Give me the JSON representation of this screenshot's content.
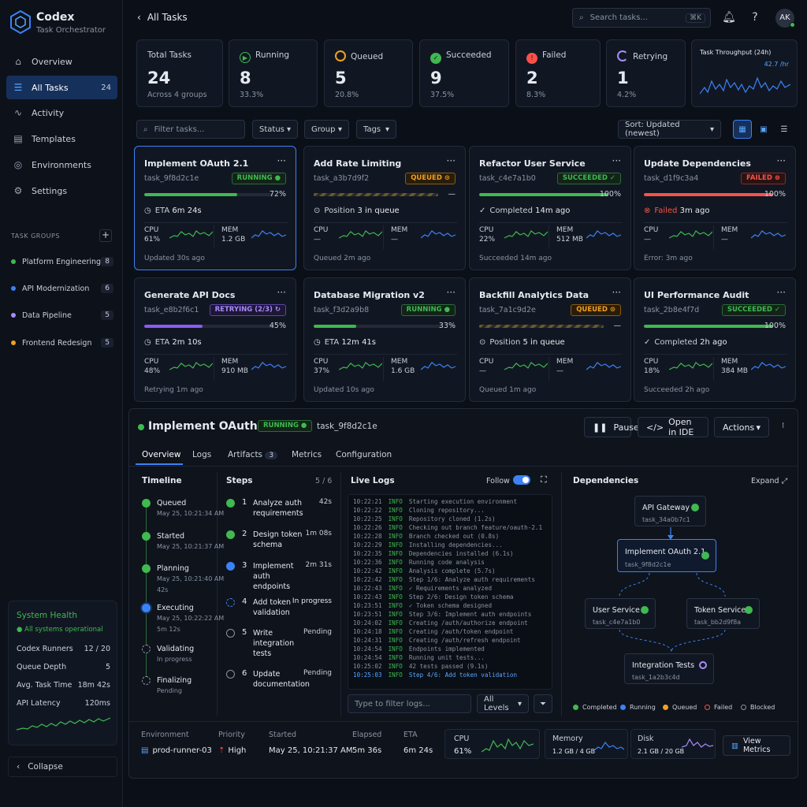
{
  "brand": {
    "name": "Codex",
    "subtitle": "Task Orchestrator"
  },
  "nav": [
    {
      "label": "Overview",
      "icon": "home-icon"
    },
    {
      "label": "All Tasks",
      "icon": "list-icon",
      "count": "24",
      "active": true
    },
    {
      "label": "Activity",
      "icon": "activity-icon"
    },
    {
      "label": "Templates",
      "icon": "template-icon"
    },
    {
      "label": "Environments",
      "icon": "environment-icon"
    },
    {
      "label": "Settings",
      "icon": "gear-icon"
    }
  ],
  "groups": {
    "title": "TASK GROUPS",
    "items": [
      {
        "label": "Platform Engineering",
        "count": "8",
        "color": "#3fb950"
      },
      {
        "label": "API Modernization",
        "count": "6",
        "color": "#3b82f6"
      },
      {
        "label": "Data Pipeline",
        "count": "5",
        "color": "#a78bfa"
      },
      {
        "label": "Frontend Redesign",
        "count": "5",
        "color": "#f0a020"
      }
    ]
  },
  "health": {
    "title": "System Health",
    "status": "All systems operational",
    "rows": [
      {
        "label": "Codex Runners",
        "value": "12 / 20"
      },
      {
        "label": "Queue Depth",
        "value": "5"
      },
      {
        "label": "Avg. Task Time",
        "value": "18m 42s"
      },
      {
        "label": "API Latency",
        "value": "120ms"
      }
    ]
  },
  "collapse_label": "Collapse",
  "topbar": {
    "title": "All Tasks",
    "search_placeholder": "Search tasks...",
    "shortcut": "⌘K",
    "avatar": "AK"
  },
  "stats": {
    "total": {
      "label": "Total Tasks",
      "value": "24",
      "sub": "Across 4 groups"
    },
    "running": {
      "label": "Running",
      "value": "8",
      "sub": "33.3%"
    },
    "queued": {
      "label": "Queued",
      "value": "5",
      "sub": "20.8%"
    },
    "succeeded": {
      "label": "Succeeded",
      "value": "9",
      "sub": "37.5%"
    },
    "failed": {
      "label": "Failed",
      "value": "2",
      "sub": "8.3%"
    },
    "retrying": {
      "label": "Retrying",
      "value": "1",
      "sub": "4.2%"
    },
    "throughput": {
      "label": "Task Throughput (24h)",
      "value": "42.7 /hr"
    }
  },
  "filters": {
    "placeholder": "Filter tasks...",
    "status": "Status",
    "group": "Group",
    "tags": "Tags",
    "sort": "Sort: Updated (newest)"
  },
  "tasks": [
    {
      "title": "Implement OAuth 2.1",
      "id": "task_9f8d2c1e",
      "status": "RUNNING",
      "progress": 72,
      "pct": "72%",
      "eta_label": "ETA",
      "eta": "6m 24s",
      "cpu": "61%",
      "mem": "1.2 GB",
      "updated": "Updated 30s ago"
    },
    {
      "title": "Add Rate Limiting",
      "id": "task_a3b7d9f2",
      "status": "QUEUED",
      "progress": null,
      "pct": "—",
      "eta_label": "Position",
      "eta": "3 in queue",
      "cpu": "—",
      "mem": "—",
      "updated": "Queued 2m ago"
    },
    {
      "title": "Refactor User Service",
      "id": "task_c4e7a1b0",
      "status": "SUCCEEDED",
      "progress": 100,
      "pct": "100%",
      "eta_label": "Completed",
      "eta": "14m ago",
      "cpu": "22%",
      "mem": "512 MB",
      "updated": "Succeeded 14m ago"
    },
    {
      "title": "Update Dependencies",
      "id": "task_d1f9c3a4",
      "status": "FAILED",
      "progress": 100,
      "pct": "100%",
      "eta_label": "Failed",
      "eta": "3m ago",
      "cpu": "—",
      "mem": "—",
      "updated": "Error: 3m ago"
    },
    {
      "title": "Generate API Docs",
      "id": "task_e8b2f6c1",
      "status": "RETRYING (2/3)",
      "progress": 45,
      "pct": "45%",
      "eta_label": "ETA",
      "eta": "2m 10s",
      "cpu": "48%",
      "mem": "910 MB",
      "updated": "Retrying 1m ago"
    },
    {
      "title": "Database Migration v2",
      "id": "task_f3d2a9b8",
      "status": "RUNNING",
      "progress": 33,
      "pct": "33%",
      "eta_label": "ETA",
      "eta": "12m 41s",
      "cpu": "37%",
      "mem": "1.6 GB",
      "updated": "Updated 10s ago"
    },
    {
      "title": "Backfill Analytics Data",
      "id": "task_7a1c9d2e",
      "status": "QUEUED",
      "progress": null,
      "pct": "—",
      "eta_label": "Position",
      "eta": "5 in queue",
      "cpu": "—",
      "mem": "—",
      "updated": "Queued 1m ago"
    },
    {
      "title": "UI Performance Audit",
      "id": "task_2b8e4f7d",
      "status": "SUCCEEDED",
      "progress": 100,
      "pct": "100%",
      "eta_label": "Completed",
      "eta": "2h ago",
      "cpu": "18%",
      "mem": "384 MB",
      "updated": "Succeeded 2h ago"
    }
  ],
  "metric_labels": {
    "cpu": "CPU",
    "mem": "MEM"
  },
  "detail": {
    "title": "Implement OAuth 2.1",
    "status": "RUNNING",
    "id": "task_9f8d2c1e",
    "buttons": {
      "pause": "Pause",
      "open_ide": "Open in IDE",
      "actions": "Actions"
    },
    "tabs": [
      "Overview",
      "Logs",
      "Artifacts",
      "Metrics",
      "Configuration"
    ],
    "artifacts_count": "3",
    "timeline_title": "Timeline",
    "timeline": [
      {
        "name": "Queued",
        "time": "May 25, 10:21:34 AM"
      },
      {
        "name": "Started",
        "time": "May 25, 10:21:37 AM"
      },
      {
        "name": "Planning",
        "time": "May 25, 10:21:40 AM",
        "dur": "42s"
      },
      {
        "name": "Executing",
        "time": "May 25, 10:22:22 AM",
        "dur": "5m 12s"
      },
      {
        "name": "Validating",
        "time": "In progress"
      },
      {
        "name": "Finalizing",
        "time": "Pending"
      }
    ],
    "steps_title": "Steps",
    "steps_count": "5 / 6",
    "steps": [
      {
        "n": "1",
        "text": "Analyze auth requirements",
        "right": "42s"
      },
      {
        "n": "2",
        "text": "Design token schema",
        "right": "1m 08s"
      },
      {
        "n": "3",
        "text": "Implement auth endpoints",
        "right": "2m 31s"
      },
      {
        "n": "4",
        "text": "Add token validation",
        "right": "In progress"
      },
      {
        "n": "5",
        "text": "Write integration tests",
        "right": "Pending"
      },
      {
        "n": "6",
        "text": "Update documentation",
        "right": "Pending"
      }
    ],
    "logs_title": "Live Logs",
    "follow_label": "Follow",
    "logs": [
      {
        "t": "10:22:21",
        "l": "INFO",
        "m": "Starting execution environment"
      },
      {
        "t": "10:22:22",
        "l": "INFO",
        "m": "Cloning repository..."
      },
      {
        "t": "10:22:25",
        "l": "INFO",
        "m": "Repository cloned (1.2s)"
      },
      {
        "t": "10:22:26",
        "l": "INFO",
        "m": "Checking out branch feature/oauth-2.1"
      },
      {
        "t": "10:22:28",
        "l": "INFO",
        "m": "Branch checked out (0.8s)"
      },
      {
        "t": "10:22:29",
        "l": "INFO",
        "m": "Installing dependencies..."
      },
      {
        "t": "10:22:35",
        "l": "INFO",
        "m": "Dependencies installed (6.1s)"
      },
      {
        "t": "10:22:36",
        "l": "INFO",
        "m": "Running code analysis"
      },
      {
        "t": "10:22:42",
        "l": "INFO",
        "m": "Analysis complete (5.7s)"
      },
      {
        "t": "10:22:42",
        "l": "INFO",
        "m": "Step 1/6: Analyze auth requirements"
      },
      {
        "t": "10:22:43",
        "l": "INFO",
        "m": "✓ Requirements analyzed"
      },
      {
        "t": "10:22:43",
        "l": "INFO",
        "m": "Step 2/6: Design token schema"
      },
      {
        "t": "10:23:51",
        "l": "INFO",
        "m": "✓ Token schema designed"
      },
      {
        "t": "10:23:51",
        "l": "INFO",
        "m": "Step 3/6: Implement auth endpoints"
      },
      {
        "t": "10:24:02",
        "l": "INFO",
        "m": "Creating /auth/authorize endpoint"
      },
      {
        "t": "10:24:18",
        "l": "INFO",
        "m": "Creating /auth/token endpoint"
      },
      {
        "t": "10:24:31",
        "l": "INFO",
        "m": "Creating /auth/refresh endpoint"
      },
      {
        "t": "10:24:54",
        "l": "INFO",
        "m": "Endpoints implemented"
      },
      {
        "t": "10:24:54",
        "l": "INFO",
        "m": "Running unit tests..."
      },
      {
        "t": "10:25:02",
        "l": "INFO",
        "m": "42 tests passed (9.1s)"
      },
      {
        "t": "10:25:03",
        "l": "INFO",
        "m": "Step 4/6: Add token validation"
      }
    ],
    "log_filter_placeholder": "Type to filter logs...",
    "log_level": "All Levels",
    "deps_title": "Dependencies",
    "expand_label": "Expand",
    "deps": [
      {
        "name": "API Gateway",
        "id": "task_34a0b7c1"
      },
      {
        "name": "Implement OAuth 2.1",
        "id": "task_9f8d2c1e"
      },
      {
        "name": "User Service",
        "id": "task_c4e7a1b0"
      },
      {
        "name": "Token Service",
        "id": "task_bb2d9f8a"
      },
      {
        "name": "Integration Tests",
        "id": "task_1a2b3c4d"
      }
    ],
    "legend": [
      "Completed",
      "Running",
      "Queued",
      "Failed",
      "Blocked"
    ],
    "env": {
      "label": "Environment",
      "value": "prod-runner-03"
    },
    "priority": {
      "label": "Priority",
      "value": "High"
    },
    "started": {
      "label": "Started",
      "value": "May 25, 10:21:37 AM"
    },
    "elapsed": {
      "label": "Elapsed",
      "value": "5m 36s"
    },
    "eta": {
      "label": "ETA",
      "value": "6m 24s"
    },
    "cpu": {
      "label": "CPU",
      "value": "61%"
    },
    "memory": {
      "label": "Memory",
      "value": "1.2 GB / 4 GB"
    },
    "disk": {
      "label": "Disk",
      "value": "2.1 GB / 20 GB"
    },
    "view_metrics": "View Metrics"
  },
  "colors": {
    "running": "#3fb950",
    "queued": "#f0a020",
    "failed": "#f85149",
    "retrying": "#a78bfa",
    "accent": "#3b82f6"
  }
}
